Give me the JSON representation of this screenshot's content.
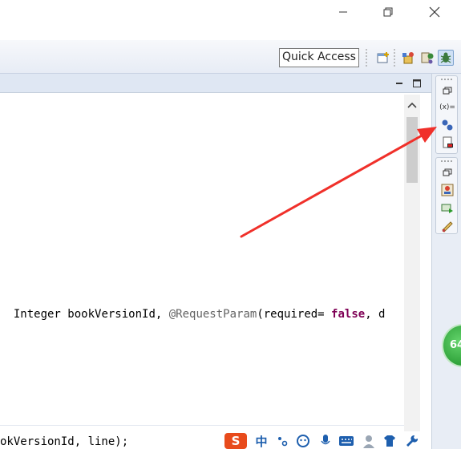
{
  "toolbar": {
    "quick_access": "Quick Access"
  },
  "editor": {
    "line1": {
      "part_type": "Integer ",
      "part_var": "bookVersionId, ",
      "part_ann": "@RequestParam",
      "part_args": "(required= ",
      "part_kw": "false",
      "part_tail": ", d"
    },
    "line2": "okVersionId, line);"
  },
  "ime": {
    "sogou": "S",
    "zh": "中"
  },
  "badge": {
    "value": "64"
  },
  "colors": {
    "arrow": "#f0302a",
    "keyword": "#7f0055",
    "annotation": "#646464",
    "badge_green": "#2fa23a"
  }
}
